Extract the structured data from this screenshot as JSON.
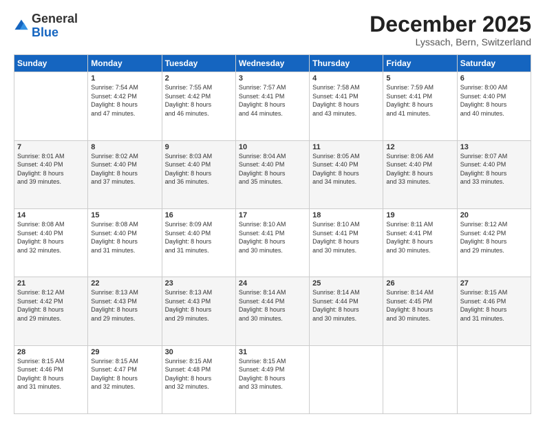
{
  "logo": {
    "general": "General",
    "blue": "Blue"
  },
  "header": {
    "month": "December 2025",
    "location": "Lyssach, Bern, Switzerland"
  },
  "weekdays": [
    "Sunday",
    "Monday",
    "Tuesday",
    "Wednesday",
    "Thursday",
    "Friday",
    "Saturday"
  ],
  "weeks": [
    [
      {
        "day": "",
        "info": ""
      },
      {
        "day": "1",
        "info": "Sunrise: 7:54 AM\nSunset: 4:42 PM\nDaylight: 8 hours\nand 47 minutes."
      },
      {
        "day": "2",
        "info": "Sunrise: 7:55 AM\nSunset: 4:42 PM\nDaylight: 8 hours\nand 46 minutes."
      },
      {
        "day": "3",
        "info": "Sunrise: 7:57 AM\nSunset: 4:41 PM\nDaylight: 8 hours\nand 44 minutes."
      },
      {
        "day": "4",
        "info": "Sunrise: 7:58 AM\nSunset: 4:41 PM\nDaylight: 8 hours\nand 43 minutes."
      },
      {
        "day": "5",
        "info": "Sunrise: 7:59 AM\nSunset: 4:41 PM\nDaylight: 8 hours\nand 41 minutes."
      },
      {
        "day": "6",
        "info": "Sunrise: 8:00 AM\nSunset: 4:40 PM\nDaylight: 8 hours\nand 40 minutes."
      }
    ],
    [
      {
        "day": "7",
        "info": "Sunrise: 8:01 AM\nSunset: 4:40 PM\nDaylight: 8 hours\nand 39 minutes."
      },
      {
        "day": "8",
        "info": "Sunrise: 8:02 AM\nSunset: 4:40 PM\nDaylight: 8 hours\nand 37 minutes."
      },
      {
        "day": "9",
        "info": "Sunrise: 8:03 AM\nSunset: 4:40 PM\nDaylight: 8 hours\nand 36 minutes."
      },
      {
        "day": "10",
        "info": "Sunrise: 8:04 AM\nSunset: 4:40 PM\nDaylight: 8 hours\nand 35 minutes."
      },
      {
        "day": "11",
        "info": "Sunrise: 8:05 AM\nSunset: 4:40 PM\nDaylight: 8 hours\nand 34 minutes."
      },
      {
        "day": "12",
        "info": "Sunrise: 8:06 AM\nSunset: 4:40 PM\nDaylight: 8 hours\nand 33 minutes."
      },
      {
        "day": "13",
        "info": "Sunrise: 8:07 AM\nSunset: 4:40 PM\nDaylight: 8 hours\nand 33 minutes."
      }
    ],
    [
      {
        "day": "14",
        "info": "Sunrise: 8:08 AM\nSunset: 4:40 PM\nDaylight: 8 hours\nand 32 minutes."
      },
      {
        "day": "15",
        "info": "Sunrise: 8:08 AM\nSunset: 4:40 PM\nDaylight: 8 hours\nand 31 minutes."
      },
      {
        "day": "16",
        "info": "Sunrise: 8:09 AM\nSunset: 4:40 PM\nDaylight: 8 hours\nand 31 minutes."
      },
      {
        "day": "17",
        "info": "Sunrise: 8:10 AM\nSunset: 4:41 PM\nDaylight: 8 hours\nand 30 minutes."
      },
      {
        "day": "18",
        "info": "Sunrise: 8:10 AM\nSunset: 4:41 PM\nDaylight: 8 hours\nand 30 minutes."
      },
      {
        "day": "19",
        "info": "Sunrise: 8:11 AM\nSunset: 4:41 PM\nDaylight: 8 hours\nand 30 minutes."
      },
      {
        "day": "20",
        "info": "Sunrise: 8:12 AM\nSunset: 4:42 PM\nDaylight: 8 hours\nand 29 minutes."
      }
    ],
    [
      {
        "day": "21",
        "info": "Sunrise: 8:12 AM\nSunset: 4:42 PM\nDaylight: 8 hours\nand 29 minutes."
      },
      {
        "day": "22",
        "info": "Sunrise: 8:13 AM\nSunset: 4:43 PM\nDaylight: 8 hours\nand 29 minutes."
      },
      {
        "day": "23",
        "info": "Sunrise: 8:13 AM\nSunset: 4:43 PM\nDaylight: 8 hours\nand 29 minutes."
      },
      {
        "day": "24",
        "info": "Sunrise: 8:14 AM\nSunset: 4:44 PM\nDaylight: 8 hours\nand 30 minutes."
      },
      {
        "day": "25",
        "info": "Sunrise: 8:14 AM\nSunset: 4:44 PM\nDaylight: 8 hours\nand 30 minutes."
      },
      {
        "day": "26",
        "info": "Sunrise: 8:14 AM\nSunset: 4:45 PM\nDaylight: 8 hours\nand 30 minutes."
      },
      {
        "day": "27",
        "info": "Sunrise: 8:15 AM\nSunset: 4:46 PM\nDaylight: 8 hours\nand 31 minutes."
      }
    ],
    [
      {
        "day": "28",
        "info": "Sunrise: 8:15 AM\nSunset: 4:46 PM\nDaylight: 8 hours\nand 31 minutes."
      },
      {
        "day": "29",
        "info": "Sunrise: 8:15 AM\nSunset: 4:47 PM\nDaylight: 8 hours\nand 32 minutes."
      },
      {
        "day": "30",
        "info": "Sunrise: 8:15 AM\nSunset: 4:48 PM\nDaylight: 8 hours\nand 32 minutes."
      },
      {
        "day": "31",
        "info": "Sunrise: 8:15 AM\nSunset: 4:49 PM\nDaylight: 8 hours\nand 33 minutes."
      },
      {
        "day": "",
        "info": ""
      },
      {
        "day": "",
        "info": ""
      },
      {
        "day": "",
        "info": ""
      }
    ]
  ]
}
